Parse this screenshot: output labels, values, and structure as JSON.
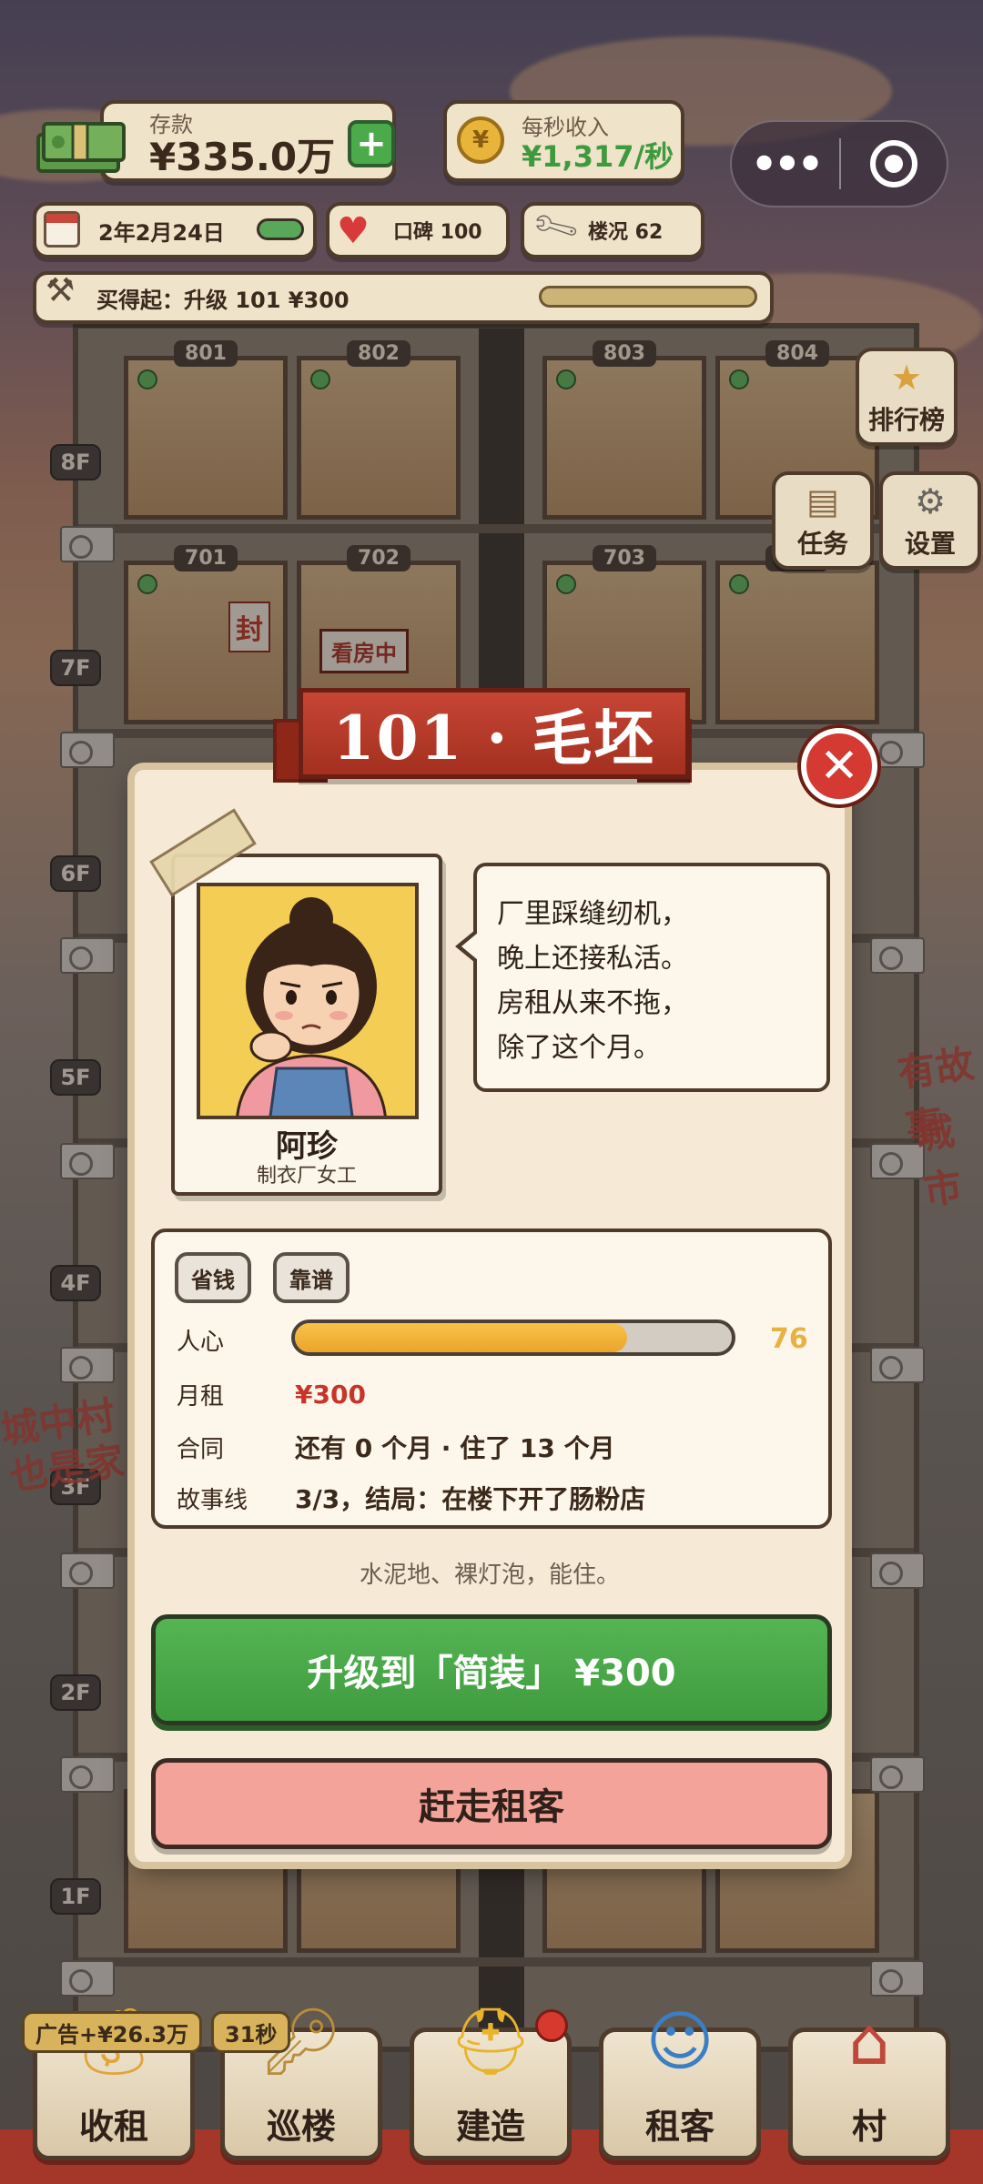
{
  "hud": {
    "money_label": "存款",
    "money_value": "¥335.0万",
    "plus_label": "+",
    "income_label": "每秒收入",
    "income_value": "¥1,317/秒",
    "coin_symbol": "¥",
    "date": "2年2月24日",
    "reputation": "口碑 100",
    "building_condition": "楼况 62",
    "afford": "买得起：升级 101 ¥300"
  },
  "side_buttons": {
    "rank": "排行榜",
    "tasks": "任务",
    "settings": "设置"
  },
  "building": {
    "floors": [
      "8F",
      "7F",
      "6F",
      "5F",
      "4F",
      "3F",
      "2F",
      "1F"
    ],
    "room_numbers": [
      "801",
      "802",
      "803",
      "804",
      "701",
      "702",
      "703",
      "704"
    ],
    "room_signs": [
      "封",
      "看房中"
    ],
    "wall_texts": [
      "城中村",
      "也是家",
      "有故事",
      "城市"
    ]
  },
  "modal": {
    "title": "101 · 毛坯",
    "close_symbol": "✕",
    "tenant_name": "阿珍",
    "tenant_job": "制衣厂女工",
    "speech_lines": [
      "厂里踩缝纫机，",
      "晚上还接私活。",
      "房租从来不拖，",
      "除了这个月。"
    ],
    "tags": [
      "省钱",
      "靠谱"
    ],
    "stats": {
      "heart_label": "人心",
      "heart_value": 76,
      "heart_display": "76",
      "rent_label": "月租",
      "rent_value": "¥300",
      "contract_label": "合同",
      "contract_value": "还有 0 个月 · 住了 13 个月",
      "story_label": "故事线",
      "story_value": "3/3，结局：在楼下开了肠粉店"
    },
    "room_description": "水泥地、裸灯泡，能住。",
    "upgrade_button": "升级到「简装」 ¥300",
    "evict_button": "赶走租客"
  },
  "bottom_nav": {
    "ad_badge": "广告+¥26.3万",
    "timer_badge": "31秒",
    "collect": "收租",
    "patrol": "巡楼",
    "build": "建造",
    "tenant": "租客",
    "village": "村"
  },
  "colors": {
    "accent_green": "#4bab4b",
    "accent_red": "#c64535",
    "heart_bar": "#f9c24a",
    "evict_pink": "#f4a39a"
  }
}
